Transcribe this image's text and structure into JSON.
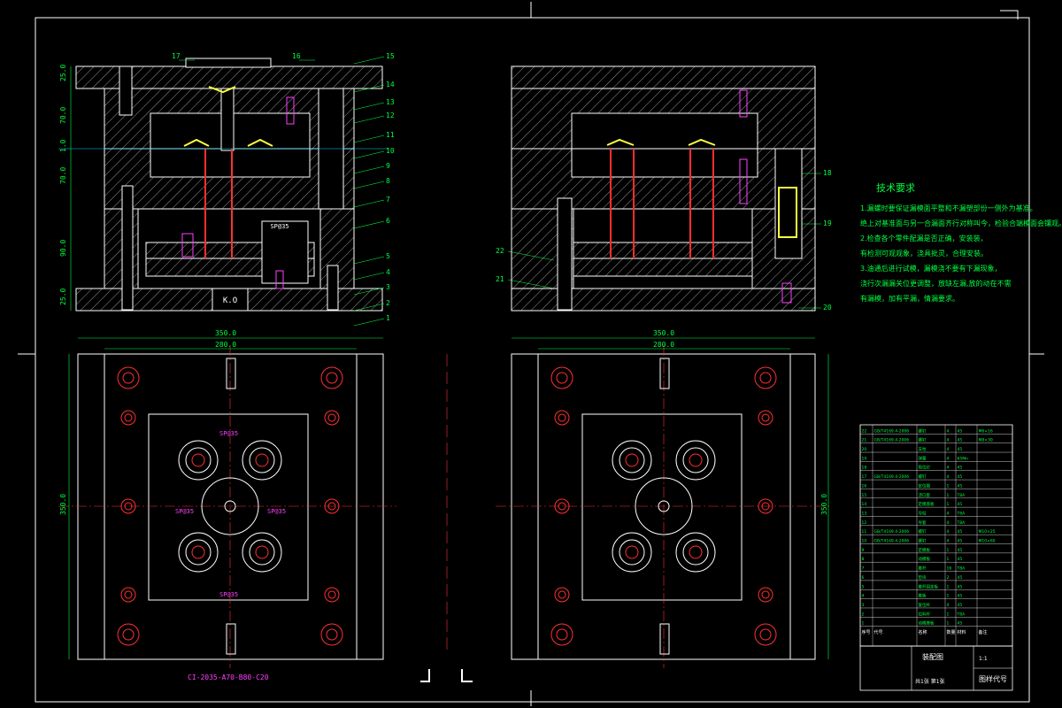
{
  "drawing": {
    "part_code": "CI-2035-A70-B80-C20",
    "section_heights": [
      "25.0",
      "70.0",
      "1.0",
      "70.0",
      "90.0",
      "25.0"
    ],
    "width_outer": "350.0",
    "width_inner": "280.0",
    "height_side": "350.0",
    "hole_label_main": "SP@35",
    "ko_label": "K.O",
    "plate_labels": [
      "SP@35",
      "SP@35",
      "SP@35",
      "SP@35"
    ]
  },
  "callouts": {
    "left": [
      "17",
      "16",
      "15",
      "14",
      "13",
      "12",
      "11",
      "10",
      "9",
      "8",
      "7",
      "6",
      "5",
      "4",
      "3",
      "2",
      "1"
    ],
    "right": [
      "18",
      "19",
      "20",
      "22",
      "21"
    ]
  },
  "tech_requirements": {
    "title": "技术要求",
    "lines": [
      "1.漏螺时要保证漏模面平整和不漏塑部份一侧外为基准。",
      "绝上对基准面与另一合漏面齐行对称叫今，检验合端模面会镶观。",
      "2.检查各个零件配漏是否正确，安装装，",
      "有检测可观观象，浇具批灵，合理安装。",
      "3.油通后进行试模，漏模浇不要有下漏现象，",
      "浇行次漏漏关位更调整，放缺左漏,放的动在不需",
      "有漏模，加有平漏，情漏要求。"
    ]
  },
  "title_block": {
    "assembly_name": "装配图",
    "drawing_no": "图样代号",
    "rows": [
      [
        "22",
        "GB/T4169.4-2006",
        "螺钉",
        "4",
        "45",
        "M6×16"
      ],
      [
        "21",
        "GB/T4169.4-2006",
        "螺钉",
        "4",
        "45",
        "M8×30"
      ],
      [
        "20",
        "",
        "支柱",
        "4",
        "45",
        ""
      ],
      [
        "19",
        "",
        "弹簧",
        "4",
        "65Mn",
        ""
      ],
      [
        "18",
        "",
        "限位钉",
        "4",
        "45",
        ""
      ],
      [
        "17",
        "GB/T4169.4-2006",
        "螺钉",
        "4",
        "45",
        ""
      ],
      [
        "16",
        "",
        "定位圈",
        "1",
        "45",
        ""
      ],
      [
        "15",
        "",
        "浇口套",
        "1",
        "T8A",
        ""
      ],
      [
        "14",
        "",
        "定模座板",
        "1",
        "45",
        ""
      ],
      [
        "13",
        "",
        "导柱",
        "4",
        "T8A",
        ""
      ],
      [
        "12",
        "",
        "导套",
        "4",
        "T8A",
        ""
      ],
      [
        "11",
        "GB/T4169.4-2006",
        "螺钉",
        "4",
        "45",
        "M10×25"
      ],
      [
        "10",
        "GB/T4169.4-2006",
        "螺钉",
        "4",
        "45",
        "M10×60"
      ],
      [
        "9",
        "",
        "定模板",
        "1",
        "45",
        ""
      ],
      [
        "8",
        "",
        "动模板",
        "1",
        "45",
        ""
      ],
      [
        "7",
        "",
        "推杆",
        "16",
        "T8A",
        ""
      ],
      [
        "6",
        "",
        "垫块",
        "2",
        "45",
        ""
      ],
      [
        "5",
        "",
        "推杆固定板",
        "1",
        "45",
        ""
      ],
      [
        "4",
        "",
        "推板",
        "1",
        "45",
        ""
      ],
      [
        "3",
        "",
        "复位杆",
        "4",
        "45",
        ""
      ],
      [
        "2",
        "",
        "拉料杆",
        "1",
        "T8A",
        ""
      ],
      [
        "1",
        "",
        "动模座板",
        "1",
        "45",
        ""
      ]
    ],
    "header": [
      "序号",
      "代号",
      "名称",
      "数量",
      "材料",
      "备注"
    ],
    "scale": "1:1",
    "sheet": "共1张 第1张"
  },
  "colors": {
    "background": "#000000",
    "outline": "#ffffff",
    "hatch": "#c8c8c8",
    "red": "#ff3030",
    "cyan": "#00d8ff",
    "green": "#00ff40",
    "magenta": "#ff40ff",
    "yellow": "#ffff40",
    "blue": "#4060ff"
  }
}
